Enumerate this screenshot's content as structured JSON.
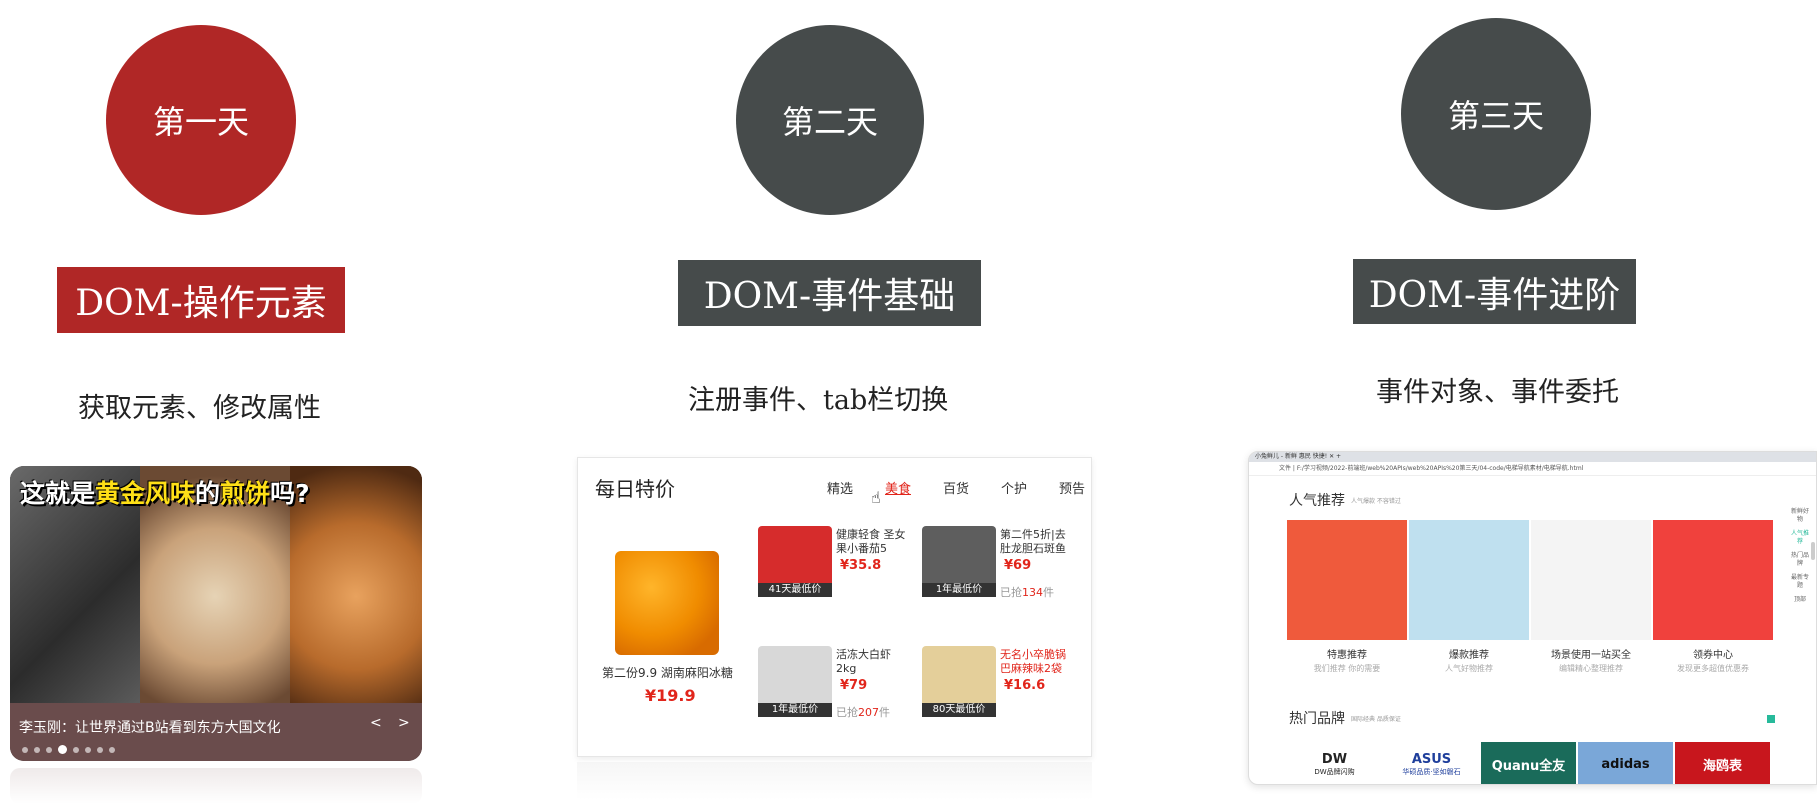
{
  "days": [
    {
      "label": "第一天",
      "color": "#b02726",
      "topic": "DOM-操作元素",
      "desc": "获取元素、修改属性"
    },
    {
      "label": "第二天",
      "color": "#464b4b",
      "topic": "DOM-事件基础",
      "desc": "注册事件、tab栏切换"
    },
    {
      "label": "第三天",
      "color": "#464b4b",
      "topic": "DOM-事件进阶",
      "desc": "事件对象、事件委托"
    }
  ],
  "carousel": {
    "headline_a": "这就是",
    "headline_b": "黄金风味",
    "headline_c": "的",
    "headline_d": "煎饼",
    "headline_e": "吗?",
    "caption": "李玉刚：让世界通过B站看到东方大国文化",
    "prev": "<",
    "next": ">",
    "dot_count": 8,
    "active_dot": 4
  },
  "deals": {
    "title": "每日特价",
    "tabs": [
      "精选",
      "美食",
      "百货",
      "个护",
      "预告"
    ],
    "active_tab": "美食",
    "feature": {
      "name": "第二份9.9 湖南麻阳冰糖",
      "price": "¥19.9"
    },
    "items": [
      {
        "name": "健康轻食 圣女果小番茄5",
        "price": "¥35.8",
        "badge": "41天最低价",
        "sold_prefix": "",
        "sold_num": "",
        "sold_suffix": "",
        "thumb": "#d62c2c",
        "red": false
      },
      {
        "name": "第二件5折|去肚龙胆石斑鱼",
        "price": "¥69",
        "badge": "1年最低价",
        "sold_prefix": "已抢",
        "sold_num": "134",
        "sold_suffix": "件",
        "thumb": "#5e5e5e",
        "red": false
      },
      {
        "name": "活冻大白虾2kg",
        "price": "¥79",
        "badge": "1年最低价",
        "sold_prefix": "已抢",
        "sold_num": "207",
        "sold_suffix": "件",
        "thumb": "#d8d8d8",
        "red": false
      },
      {
        "name": "无名小卒脆锅巴麻辣味2袋",
        "price": "¥16.6",
        "badge": "80天最低价",
        "sold_prefix": "",
        "sold_num": "",
        "sold_suffix": "",
        "thumb": "#e4cf9a",
        "red": true
      }
    ]
  },
  "browser": {
    "tab_text": "小兔鲜儿 - 新鲜 惠民 快捷!",
    "url": "文件 | F:/学习视频/2022-前端班/web%20APIs/web%20APIs%20第三天/04-code/电梯导航素材/电梯导航.html",
    "popular_title": "人气推荐",
    "popular_sub": "人气爆款 不容错过",
    "tiles": [
      {
        "label": "特惠推荐",
        "desc": "我们推荐 你的需要",
        "color": "#ef5a3c"
      },
      {
        "label": "爆款推荐",
        "desc": "人气好物推荐",
        "color": "#bfe0ef"
      },
      {
        "label": "场景使用一站买全",
        "desc": "编辑精心整理推荐",
        "color": "#f4f4f4"
      },
      {
        "label": "领券中心",
        "desc": "发现更多超值优惠券",
        "color": "#f0413d"
      }
    ],
    "brands_title": "热门品牌",
    "brands_sub": "国际经典 品质保证",
    "brands": [
      {
        "name": "DW",
        "sub": "DW品牌闪购",
        "bg": "#ffffff",
        "fg": "#222222"
      },
      {
        "name": "ASUS",
        "sub": "华硕品质·坚如磐石",
        "bg": "#ffffff",
        "fg": "#1f3f9c"
      },
      {
        "name": "Quanu全友",
        "sub": "",
        "bg": "#1a6b5a",
        "fg": "#ffffff"
      },
      {
        "name": "adidas",
        "sub": "",
        "bg": "#7aa7d8",
        "fg": "#111111"
      },
      {
        "name": "海鸥表",
        "sub": "",
        "bg": "#c8161d",
        "fg": "#ffffff"
      }
    ],
    "side_items": [
      "新鲜好物",
      "人气推荐",
      "热门品牌",
      "最新专题",
      "顶部"
    ]
  }
}
